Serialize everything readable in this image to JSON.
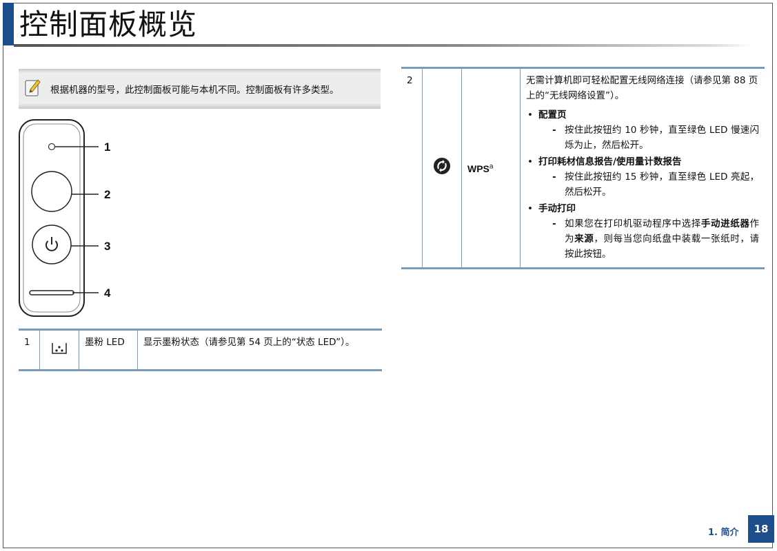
{
  "header": {
    "title": "控制面板概览"
  },
  "note": {
    "text": "根据机器的型号，此控制面板可能与本机不同。控制面板有许多类型。"
  },
  "panel": {
    "callouts": [
      "1",
      "2",
      "3",
      "4"
    ]
  },
  "table1": {
    "rows": [
      {
        "num": "1",
        "icon": "toner-icon",
        "name": "墨粉 LED",
        "desc": "显示墨粉状态（请参见第 54 页上的“状态 LED”）。"
      }
    ]
  },
  "table2": {
    "rows": [
      {
        "num": "2",
        "icon": "wps-icon",
        "name": "WPS",
        "name_sup": "a",
        "intro": "无需计算机即可轻松配置无线网络连接（请参见第 88 页上的“无线网络设置”）。",
        "items": [
          {
            "title": "配置页",
            "detail": "按住此按钮约 10 秒钟，直至绿色 LED 慢速闪烁为止，然后松开。"
          },
          {
            "title": "打印耗材信息报告/使用量计数报告",
            "detail": "按住此按钮约 15 秒钟，直至绿色 LED 亮起，然后松开。"
          },
          {
            "title": "手动打印",
            "detail_pre": "如果您在打印机驱动程序中选择",
            "detail_b1": "手动进纸器",
            "detail_mid": "作为",
            "detail_b2": "来源",
            "detail_post": "，则每当您向纸盘中装载一张纸时，请按此按钮。"
          }
        ]
      }
    ]
  },
  "footer": {
    "chapter": "1. 简介",
    "page": "18"
  }
}
